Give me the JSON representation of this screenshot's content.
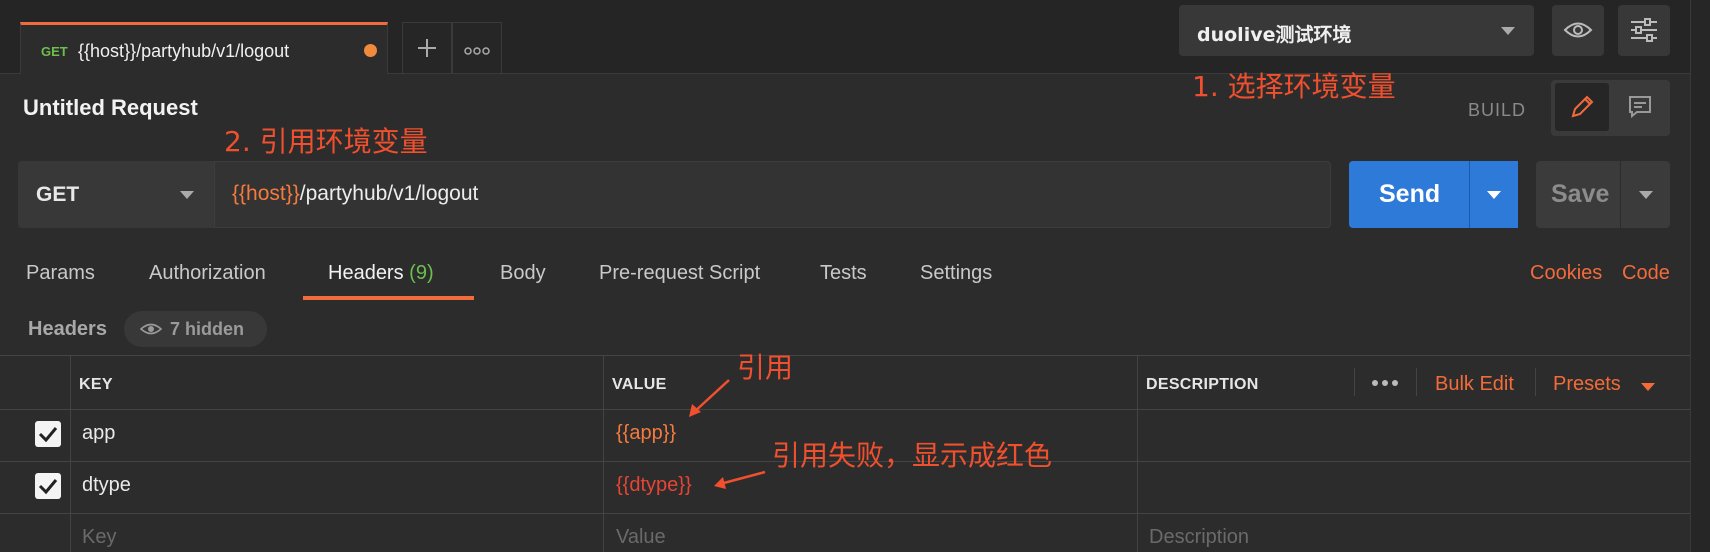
{
  "tab": {
    "method": "GET",
    "url": "{{host}}/partyhub/v1/logout"
  },
  "environment": {
    "selected": "duolive测试环境"
  },
  "request": {
    "title": "Untitled Request",
    "mode": "BUILD",
    "method": "GET",
    "url_var": "{{host}}",
    "url_path": "/partyhub/v1/logout",
    "send": "Send",
    "save": "Save"
  },
  "tabs": [
    {
      "label": "Params"
    },
    {
      "label": "Authorization"
    },
    {
      "label": "Headers",
      "count": "(9)"
    },
    {
      "label": "Body"
    },
    {
      "label": "Pre-request Script"
    },
    {
      "label": "Tests"
    },
    {
      "label": "Settings"
    }
  ],
  "links": {
    "cookies": "Cookies",
    "code": "Code"
  },
  "headers_section": {
    "label": "Headers",
    "hidden": "7 hidden"
  },
  "table": {
    "columns": {
      "key": "KEY",
      "value": "VALUE",
      "description": "DESCRIPTION"
    },
    "bulk_edit": "Bulk Edit",
    "presets": "Presets",
    "rows": [
      {
        "checked": true,
        "key": "app",
        "value": "{{app}}",
        "resolved": true
      },
      {
        "checked": true,
        "key": "dtype",
        "value": "{{dtype}}",
        "resolved": false
      }
    ],
    "placeholders": {
      "key": "Key",
      "value": "Value",
      "description": "Description"
    }
  },
  "annotations": {
    "select_env": "1. 选择环境变量",
    "use_env": "2. 引用环境变量",
    "reference": "引用",
    "reference_failed": "引用失败，显示成红色"
  },
  "colors": {
    "accent": "#f26b3a",
    "send": "#2d7ad8",
    "var_ok": "#f57a3f",
    "var_bad": "#e64535",
    "annotation": "#f0502d"
  }
}
